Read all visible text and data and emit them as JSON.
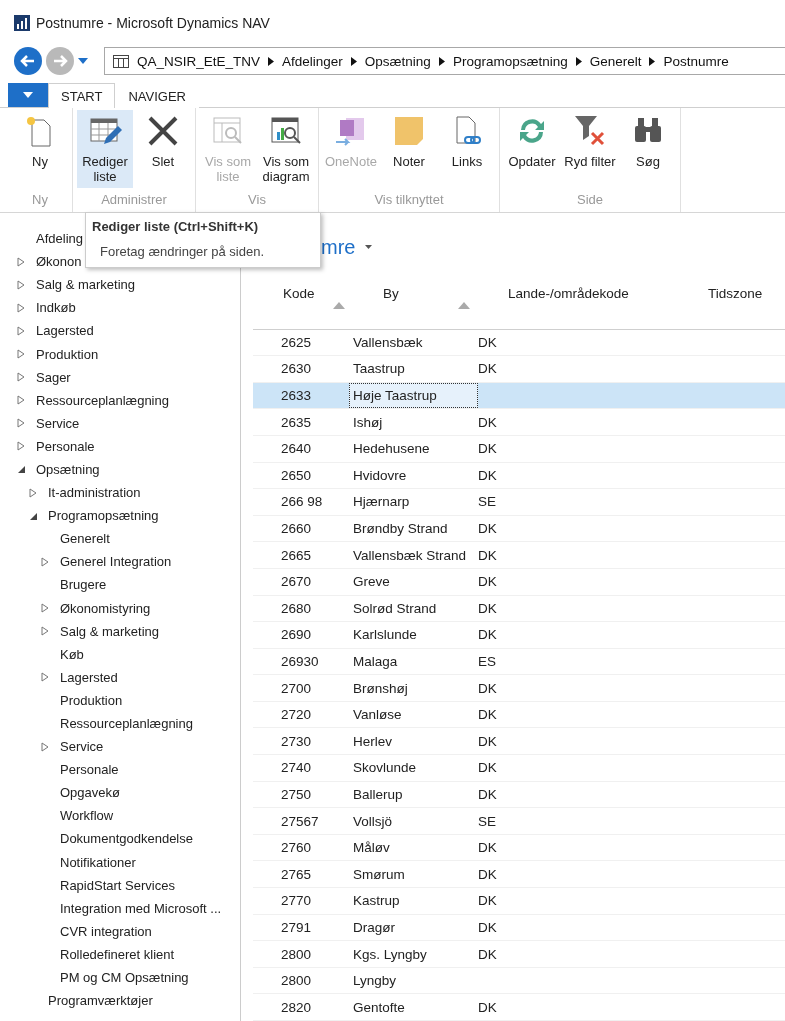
{
  "window": {
    "title": "Postnumre - Microsoft Dynamics NAV"
  },
  "breadcrumb": [
    "QA_NSIR_EtE_TNV",
    "Afdelinger",
    "Opsætning",
    "Programopsætning",
    "Generelt",
    "Postnumre"
  ],
  "tabs": [
    {
      "label": "START",
      "selected": true
    },
    {
      "label": "NAVIGER",
      "selected": false
    }
  ],
  "ribbon_groups": [
    {
      "label": "Ny",
      "buttons": [
        {
          "kind": "new",
          "label": "Ny",
          "disabled": false,
          "selected": false
        }
      ]
    },
    {
      "label": "Administrer",
      "buttons": [
        {
          "kind": "edit",
          "label": "Rediger liste",
          "disabled": false,
          "selected": true
        },
        {
          "kind": "delete",
          "label": "Slet",
          "disabled": false,
          "selected": false
        }
      ]
    },
    {
      "label": "Vis",
      "buttons": [
        {
          "kind": "list",
          "label": "Vis som liste",
          "disabled": true,
          "selected": false
        },
        {
          "kind": "chart",
          "label": "Vis som diagram",
          "disabled": false,
          "selected": false
        }
      ]
    },
    {
      "label": "Vis tilknyttet",
      "buttons": [
        {
          "kind": "onenote",
          "label": "OneNote",
          "disabled": true,
          "selected": false
        },
        {
          "kind": "note",
          "label": "Noter",
          "disabled": false,
          "selected": false
        },
        {
          "kind": "links",
          "label": "Links",
          "disabled": false,
          "selected": false
        }
      ]
    },
    {
      "label": "Side",
      "buttons": [
        {
          "kind": "refresh",
          "label": "Opdater",
          "disabled": false,
          "selected": false
        },
        {
          "kind": "filter",
          "label": "Ryd filter",
          "disabled": false,
          "selected": false
        },
        {
          "kind": "find",
          "label": "Søg",
          "disabled": false,
          "selected": false
        }
      ]
    }
  ],
  "tooltip": {
    "title": "Rediger liste (Ctrl+Shift+K)",
    "text": "Foretag ændringer på siden."
  },
  "sidebar": [
    {
      "label": "Afdeling"
    },
    {
      "label": "Økonon",
      "expanded": false
    },
    {
      "label": "Salg & marketing",
      "expanded": false
    },
    {
      "label": "Indkøb",
      "expanded": false
    },
    {
      "label": "Lagersted",
      "expanded": false
    },
    {
      "label": "Produktion",
      "expanded": false
    },
    {
      "label": "Sager",
      "expanded": false
    },
    {
      "label": "Ressourceplanlægning",
      "expanded": false
    },
    {
      "label": "Service",
      "expanded": false
    },
    {
      "label": "Personale",
      "expanded": false
    },
    {
      "label": "Opsætning",
      "expanded": true,
      "children": [
        {
          "label": "It-administration",
          "expanded": false
        },
        {
          "label": "Programopsætning",
          "expanded": true,
          "children": [
            {
              "label": "Generelt"
            },
            {
              "label": "Generel Integration",
              "expanded": false
            },
            {
              "label": "Brugere"
            },
            {
              "label": "Økonomistyring",
              "expanded": false
            },
            {
              "label": "Salg & marketing",
              "expanded": false
            },
            {
              "label": "Køb"
            },
            {
              "label": "Lagersted",
              "expanded": false
            },
            {
              "label": "Produktion"
            },
            {
              "label": "Ressourceplanlægning"
            },
            {
              "label": "Service",
              "expanded": false
            },
            {
              "label": "Personale"
            },
            {
              "label": "Opgavekø"
            },
            {
              "label": "Workflow"
            },
            {
              "label": "Dokumentgodkendelse"
            },
            {
              "label": "Notifikationer"
            },
            {
              "label": "RapidStart Services"
            },
            {
              "label": "Integration med Microsoft ..."
            },
            {
              "label": "CVR integration"
            },
            {
              "label": "Rolledefineret klient"
            },
            {
              "label": "PM og CM Opsætning"
            }
          ]
        },
        {
          "label": "Programværktøjer"
        }
      ]
    }
  ],
  "page_title": "mre",
  "table": {
    "columns": [
      {
        "label": "Kode",
        "sort_arrow": true
      },
      {
        "label": "By",
        "sort_arrow": true
      },
      {
        "label": "Lande-/områdekode",
        "sort_arrow": false
      },
      {
        "label": "Tidszone",
        "sort_arrow": false
      }
    ],
    "rows": [
      {
        "cells": [
          "2625",
          "Vallensbæk",
          "DK"
        ],
        "selected": false
      },
      {
        "cells": [
          "2630",
          "Taastrup",
          "DK"
        ],
        "selected": false
      },
      {
        "cells": [
          "2633",
          "Høje Taastrup",
          ""
        ],
        "selected": true
      },
      {
        "cells": [
          "2635",
          "Ishøj",
          "DK"
        ],
        "selected": false
      },
      {
        "cells": [
          "2640",
          "Hedehusene",
          "DK"
        ],
        "selected": false
      },
      {
        "cells": [
          "2650",
          "Hvidovre",
          "DK"
        ],
        "selected": false
      },
      {
        "cells": [
          "266 98",
          "Hjærnarp",
          "SE"
        ],
        "selected": false
      },
      {
        "cells": [
          "2660",
          "Brøndby Strand",
          "DK"
        ],
        "selected": false
      },
      {
        "cells": [
          "2665",
          "Vallensbæk Strand",
          "DK"
        ],
        "selected": false
      },
      {
        "cells": [
          "2670",
          "Greve",
          "DK"
        ],
        "selected": false
      },
      {
        "cells": [
          "2680",
          "Solrød Strand",
          "DK"
        ],
        "selected": false
      },
      {
        "cells": [
          "2690",
          "Karlslunde",
          "DK"
        ],
        "selected": false
      },
      {
        "cells": [
          "26930",
          "Malaga",
          "ES"
        ],
        "selected": false
      },
      {
        "cells": [
          "2700",
          "Brønshøj",
          "DK"
        ],
        "selected": false
      },
      {
        "cells": [
          "2720",
          "Vanløse",
          "DK"
        ],
        "selected": false
      },
      {
        "cells": [
          "2730",
          "Herlev",
          "DK"
        ],
        "selected": false
      },
      {
        "cells": [
          "2740",
          "Skovlunde",
          "DK"
        ],
        "selected": false
      },
      {
        "cells": [
          "2750",
          "Ballerup",
          "DK"
        ],
        "selected": false
      },
      {
        "cells": [
          "27567",
          "Vollsjö",
          "SE"
        ],
        "selected": false
      },
      {
        "cells": [
          "2760",
          "Måløv",
          "DK"
        ],
        "selected": false
      },
      {
        "cells": [
          "2765",
          "Smørum",
          "DK"
        ],
        "selected": false
      },
      {
        "cells": [
          "2770",
          "Kastrup",
          "DK"
        ],
        "selected": false
      },
      {
        "cells": [
          "2791",
          "Dragør",
          "DK"
        ],
        "selected": false
      },
      {
        "cells": [
          "2800",
          "Kgs. Lyngby",
          "DK"
        ],
        "selected": false
      },
      {
        "cells": [
          "2800",
          "Lyngby",
          ""
        ],
        "selected": false
      },
      {
        "cells": [
          "2820",
          "Gentofte",
          "DK"
        ],
        "selected": false
      }
    ]
  }
}
